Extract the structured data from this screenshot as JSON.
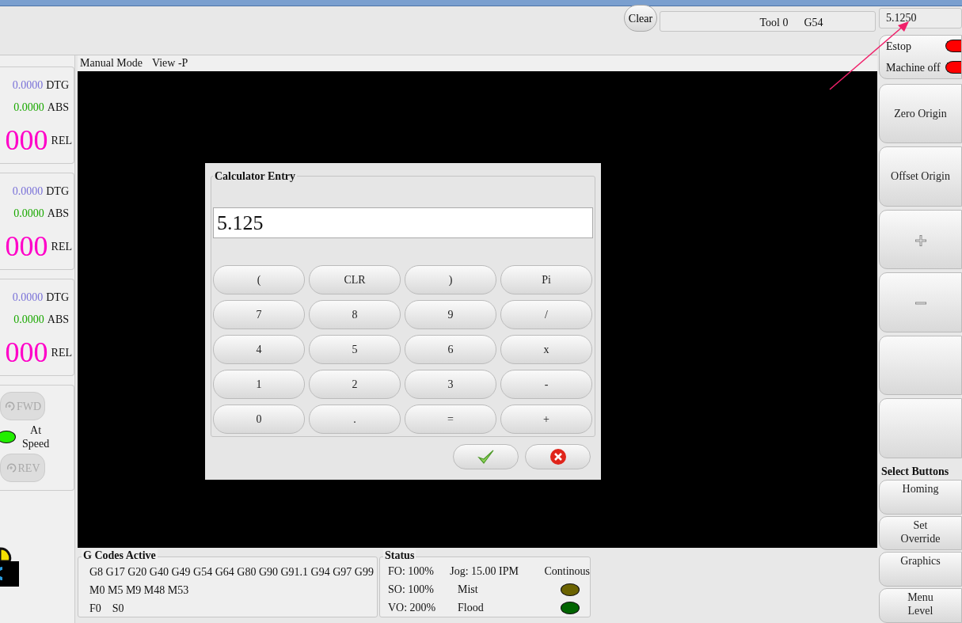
{
  "toolbar": {
    "clear_button": "Clear",
    "tool_display": [
      "Tool 0",
      "G54"
    ],
    "entry_field": {
      "value": "5.1250"
    }
  },
  "dro": [
    {
      "dtg": "0.0000",
      "dtg_label": "DTG",
      "abs": "0.0000",
      "abs_label": "ABS",
      "rel": "000",
      "rel_label": "REL"
    },
    {
      "dtg": "0.0000",
      "dtg_label": "DTG",
      "abs": "0.0000",
      "abs_label": "ABS",
      "rel": "000",
      "rel_label": "REL"
    },
    {
      "dtg": "0.0000",
      "dtg_label": "DTG",
      "abs": "0.0000",
      "abs_label": "ABS",
      "rel": "000",
      "rel_label": "REL"
    }
  ],
  "spindle": {
    "fwd": {
      "label": "FWD",
      "disabled": true
    },
    "at_speed": {
      "lines": [
        "At",
        "Speed"
      ],
      "on": true
    },
    "rev": {
      "label": "REV",
      "disabled": true
    }
  },
  "view_header": [
    "Manual Mode",
    "View -P"
  ],
  "calculator": {
    "title": "Calculator Entry",
    "display": "5.125",
    "keys": [
      "(",
      "CLR",
      ")",
      "Pi",
      "7",
      "8",
      "9",
      "/",
      "4",
      "5",
      "6",
      "x",
      "1",
      "2",
      "3",
      "-",
      "0",
      ".",
      "=",
      "+"
    ]
  },
  "gcodes": {
    "title": "G Codes Active",
    "lines": [
      [
        "G8 G17 G20 G40 G49 G54 G64 G80 G90 G91.1 G94 G97 G99"
      ],
      [
        "M0 M5 M9 M48 M53"
      ],
      [
        "F0",
        "S0"
      ]
    ]
  },
  "status": {
    "title": "Status",
    "rows": [
      {
        "override": "FO: 100%",
        "label": "Jog: 15.00 IPM",
        "kind": "text",
        "value": "Continous"
      },
      {
        "override": "SO: 100%",
        "label": "Mist",
        "kind": "led",
        "color": "#6b6300"
      },
      {
        "override": "VO: 200%",
        "label": "Flood",
        "kind": "led",
        "color": "#006400"
      }
    ]
  },
  "right_panel": {
    "indicators": [
      {
        "label": "Estop",
        "on": true
      },
      {
        "label": "Machine off",
        "on": true
      }
    ],
    "buttons": [
      {
        "kind": "text",
        "label": "Zero Origin"
      },
      {
        "kind": "text",
        "label": "Offset Origin"
      },
      {
        "kind": "plus"
      },
      {
        "kind": "minus"
      },
      {
        "kind": "blank"
      },
      {
        "kind": "blank"
      }
    ],
    "select_title": "Select Buttons",
    "select_buttons": [
      {
        "lines": [
          "Homing"
        ]
      },
      {
        "lines": [
          "Set",
          "Override"
        ]
      },
      {
        "lines": [
          "Graphics"
        ]
      },
      {
        "lines": [
          "Menu",
          "Level"
        ]
      }
    ]
  }
}
